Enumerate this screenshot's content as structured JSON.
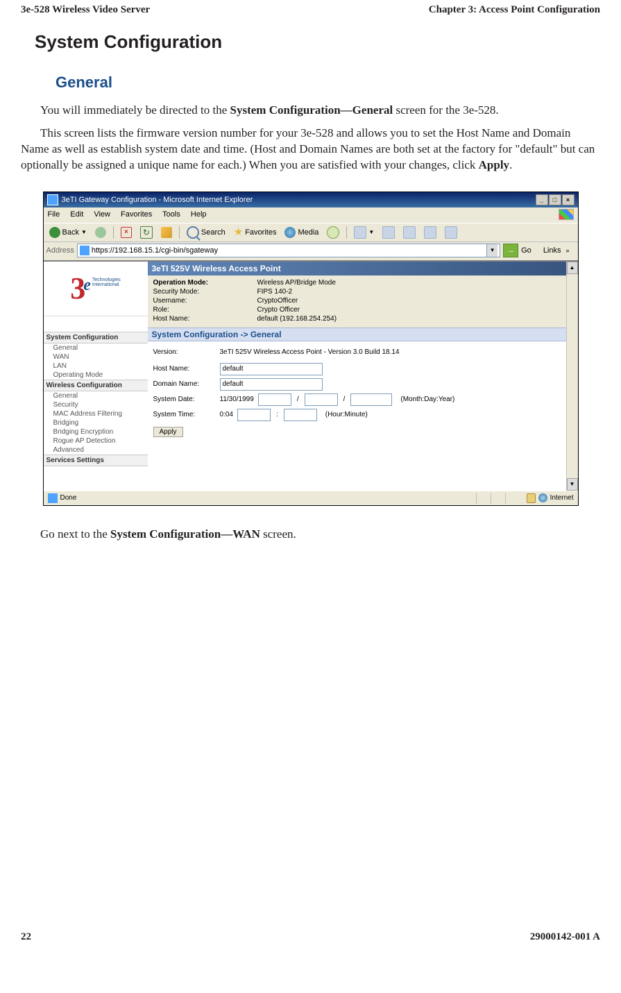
{
  "header": {
    "left": "3e-528 Wireless Video Server",
    "right": "Chapter 3: Access Point Configuration"
  },
  "h1": "System Configuration",
  "h2": "General",
  "para1_a": "You will immediately be directed to the ",
  "para1_b": "System Configuration—General",
  "para1_c": " screen for the 3e-528.",
  "para2_a": "This screen lists the firmware version number for your 3e-528 and allows you to set the Host Name and Domain Name as well as establish system date and time. (Host and Domain Names are both set at the factory for \"default\" but can optionally be assigned a unique name for each.) When you are satisfied with your changes, click ",
  "para2_b": "Apply",
  "para2_c": ".",
  "para3_a": "Go next to the ",
  "para3_b": "System Configuration—WAN",
  "para3_c": " screen.",
  "footer": {
    "left": "22",
    "right": "29000142-001 A"
  },
  "ss": {
    "title": "3eTI Gateway Configuration - Microsoft Internet Explorer",
    "menus": [
      "File",
      "Edit",
      "View",
      "Favorites",
      "Tools",
      "Help"
    ],
    "toolbar": {
      "back": "Back",
      "search": "Search",
      "favorites": "Favorites",
      "media": "Media"
    },
    "address_label": "Address",
    "url": "https://192.168.15.1/cgi-bin/sgateway",
    "go": "Go",
    "links": "Links",
    "logo_tech": "Technologies",
    "logo_intl": "International",
    "nav": {
      "g1": "System Configuration",
      "g1items": [
        "General",
        "WAN",
        "LAN",
        "Operating Mode"
      ],
      "g2": "Wireless Configuration",
      "g2items": [
        "General",
        "Security",
        "MAC Address Filtering",
        "Bridging",
        "Bridging Encryption",
        "Rogue AP Detection",
        "Advanced"
      ],
      "g3": "Services Settings"
    },
    "pane_title": "3eTI 525V Wireless Access Point",
    "info": [
      {
        "label": "Operation Mode:",
        "value": "Wireless AP/Bridge Mode",
        "bold": true
      },
      {
        "label": "Security Mode:",
        "value": "FIPS 140-2"
      },
      {
        "label": "Username:",
        "value": "CryptoOfficer"
      },
      {
        "label": "Role:",
        "value": "Crypto Officer"
      },
      {
        "label": "Host Name:",
        "value": "default (192.168.254.254)"
      }
    ],
    "section_bar": "System Configuration -> General",
    "form": {
      "version_lbl": "Version:",
      "version_val": "3eTI 525V Wireless Access Point - Version 3.0 Build 18.14",
      "host_lbl": "Host Name:",
      "host_val": "default",
      "domain_lbl": "Domain Name:",
      "domain_val": "default",
      "date_lbl": "System Date:",
      "date_val": "11/30/1999",
      "date_hint": "(Month:Day:Year)",
      "time_lbl": "System Time:",
      "time_val": "0:04",
      "time_hint": "(Hour:Minute)",
      "apply": "Apply"
    },
    "status": {
      "done": "Done",
      "zone": "Internet"
    }
  }
}
